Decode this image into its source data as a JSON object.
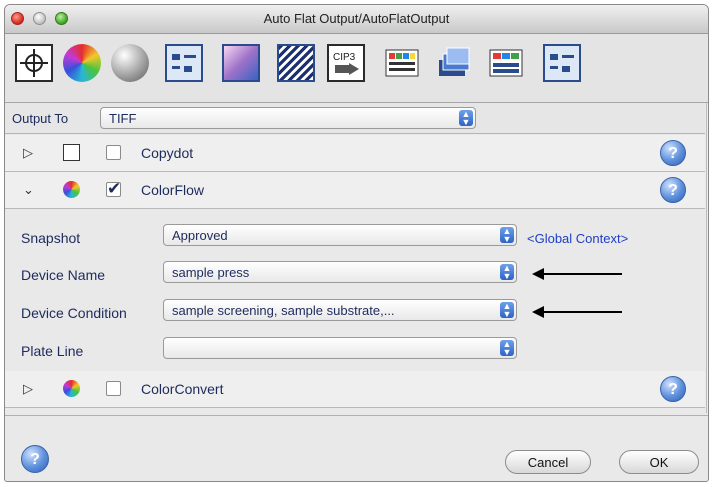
{
  "window": {
    "title": "Auto Flat Output/AutoFlatOutput"
  },
  "toolbar": {
    "items": [
      {
        "icon": "target-icon"
      },
      {
        "icon": "color-wheel-icon"
      },
      {
        "icon": "gray-sphere-icon"
      },
      {
        "icon": "ul-frame-icon"
      },
      {
        "icon": "gradient-icon"
      },
      {
        "icon": "halftone-icon"
      },
      {
        "icon": "cip3-export-icon"
      },
      {
        "icon": "color-bars-icon"
      },
      {
        "icon": "stacked-pages-icon"
      },
      {
        "icon": "color-bars-stack-icon"
      },
      {
        "icon": "ul-frame-icon"
      }
    ]
  },
  "output": {
    "label": "Output To",
    "value": "TIFF"
  },
  "sections": {
    "copydot": {
      "label": "Copydot",
      "checked": false,
      "expanded": false
    },
    "colorflow": {
      "label": "ColorFlow",
      "checked": true,
      "expanded": true
    },
    "colorconvert": {
      "label": "ColorConvert",
      "checked": false,
      "expanded": false
    }
  },
  "colorflow_fields": {
    "snapshot": {
      "label": "Snapshot",
      "value": "Approved"
    },
    "device_name": {
      "label": "Device Name",
      "value": "sample press"
    },
    "device_condition": {
      "label": "Device Condition",
      "value": "sample screening, sample substrate,..."
    },
    "plate_line": {
      "label": "Plate Line",
      "value": ""
    }
  },
  "global_context": "<Global Context>",
  "glyphs": {
    "collapsed": "▷",
    "expanded": "⌄",
    "help": "?",
    "up": "▲",
    "down": "▼"
  },
  "buttons": {
    "cancel": "Cancel",
    "ok": "OK"
  },
  "colors": {
    "accent": "#2d63c7",
    "label": "#1d2b5c",
    "link": "#1f3ec5"
  }
}
